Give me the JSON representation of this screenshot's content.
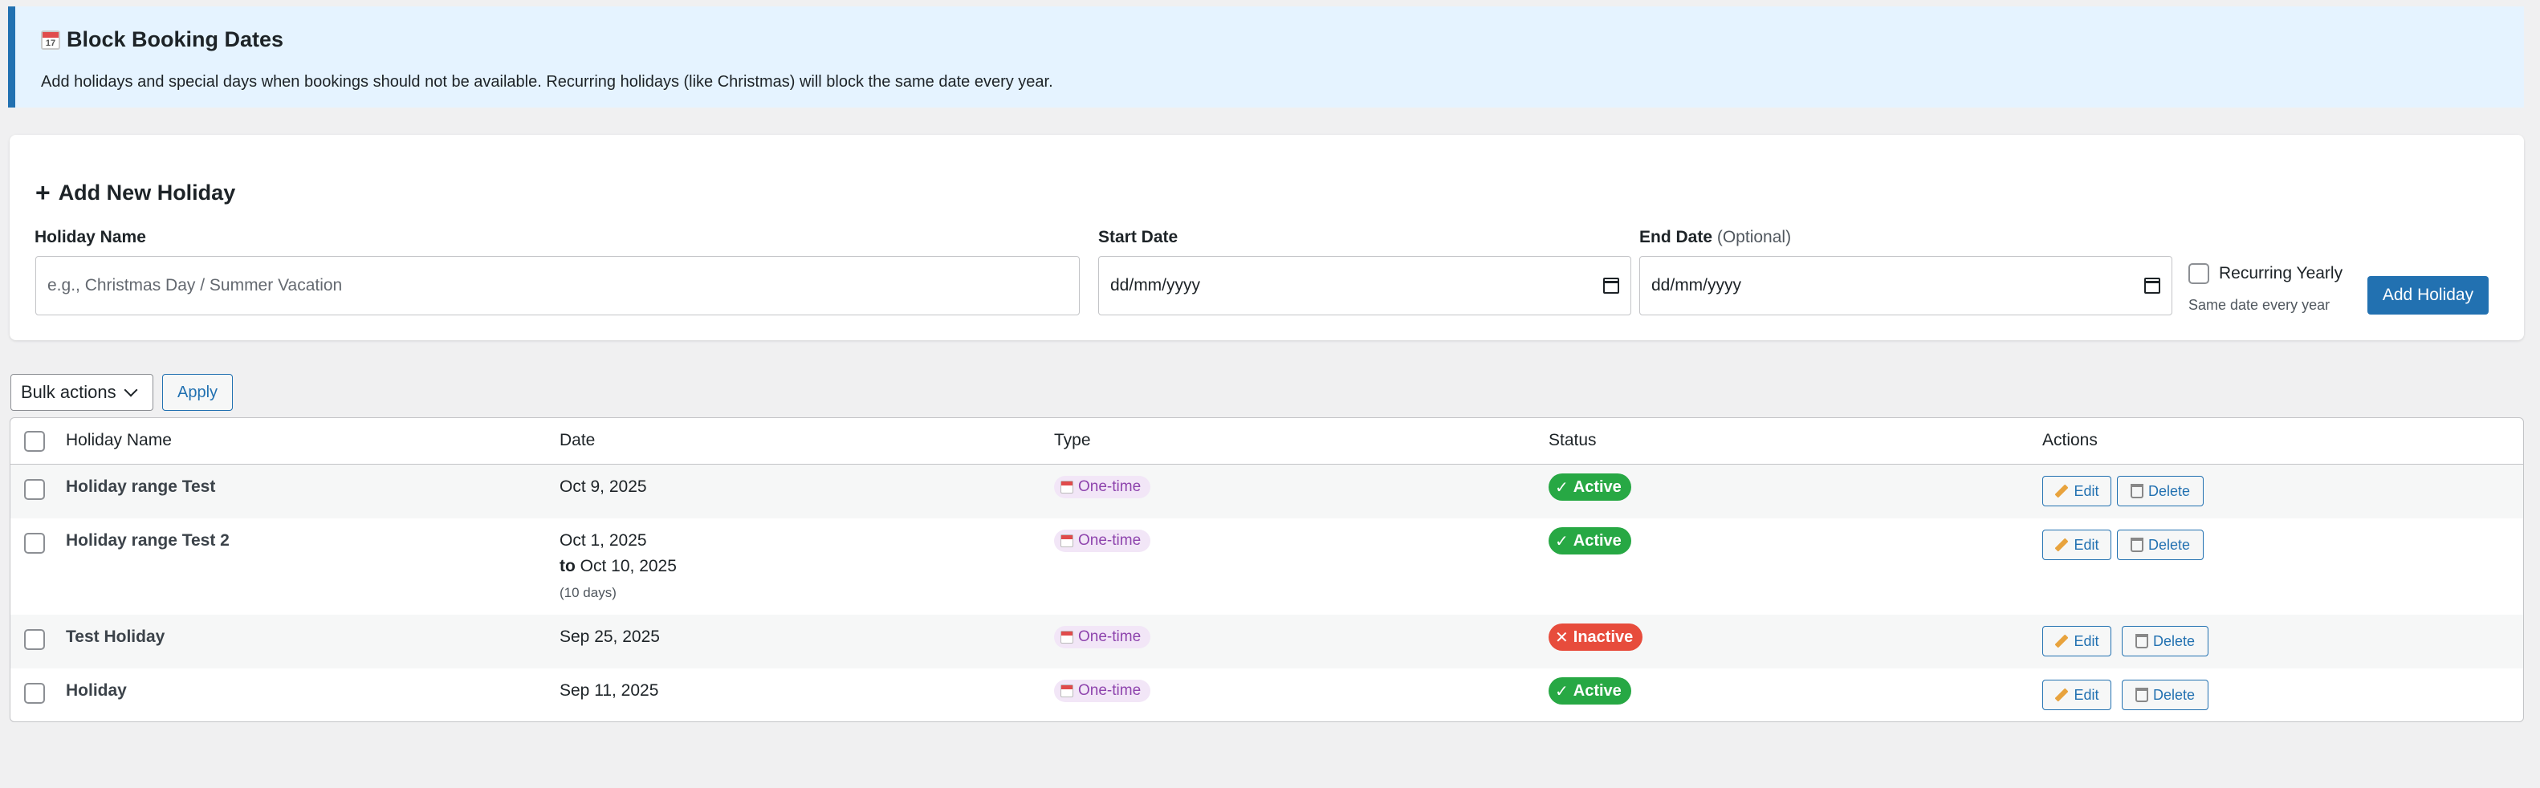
{
  "notice": {
    "title": "Block Booking Dates",
    "description": "Add holidays and special days when bookings should not be available. Recurring holidays (like Christmas) will block the same date every year."
  },
  "form": {
    "title": "Add New Holiday",
    "name_label": "Holiday Name",
    "name_placeholder": "e.g., Christmas Day / Summer Vacation",
    "start_label": "Start Date",
    "start_value": "dd/mm/yyyy",
    "end_label": "End Date",
    "end_optional": "(Optional)",
    "end_value": "dd/mm/yyyy",
    "recurring_label": "Recurring Yearly",
    "recurring_help": "Same date every year",
    "submit_label": "Add Holiday"
  },
  "bulk": {
    "select_label": "Bulk actions",
    "apply_label": "Apply"
  },
  "table": {
    "headers": {
      "name": "Holiday Name",
      "date": "Date",
      "type": "Type",
      "status": "Status",
      "actions": "Actions"
    },
    "rows": [
      {
        "name": "Holiday range Test",
        "date": "Oct 9, 2025",
        "type": "One-time",
        "status": "Active"
      },
      {
        "name": "Holiday range Test 2",
        "date": "Oct 1, 2025",
        "to_label": "to",
        "end_date": "Oct 10, 2025",
        "duration": "(10 days)",
        "type": "One-time",
        "status": "Active"
      },
      {
        "name": "Test Holiday",
        "date": "Sep 25, 2025",
        "type": "One-time",
        "status": "Inactive"
      },
      {
        "name": "Holiday",
        "date": "Sep 11, 2025",
        "type": "One-time",
        "status": "Active"
      }
    ],
    "edit_label": "Edit",
    "delete_label": "Delete",
    "check_mark": "✓",
    "cross_mark": "✕"
  },
  "colors": {
    "accent": "#2271b1",
    "active": "#27a844",
    "inactive": "#e74c3c",
    "type_pill": "#f2e6f7"
  },
  "icons": {
    "notice": "calendar-icon",
    "form_title": "plus-icon",
    "type": "calendar-icon",
    "edit": "pencil-icon",
    "delete": "trash-icon",
    "date_picker": "calendar-picker-icon"
  }
}
